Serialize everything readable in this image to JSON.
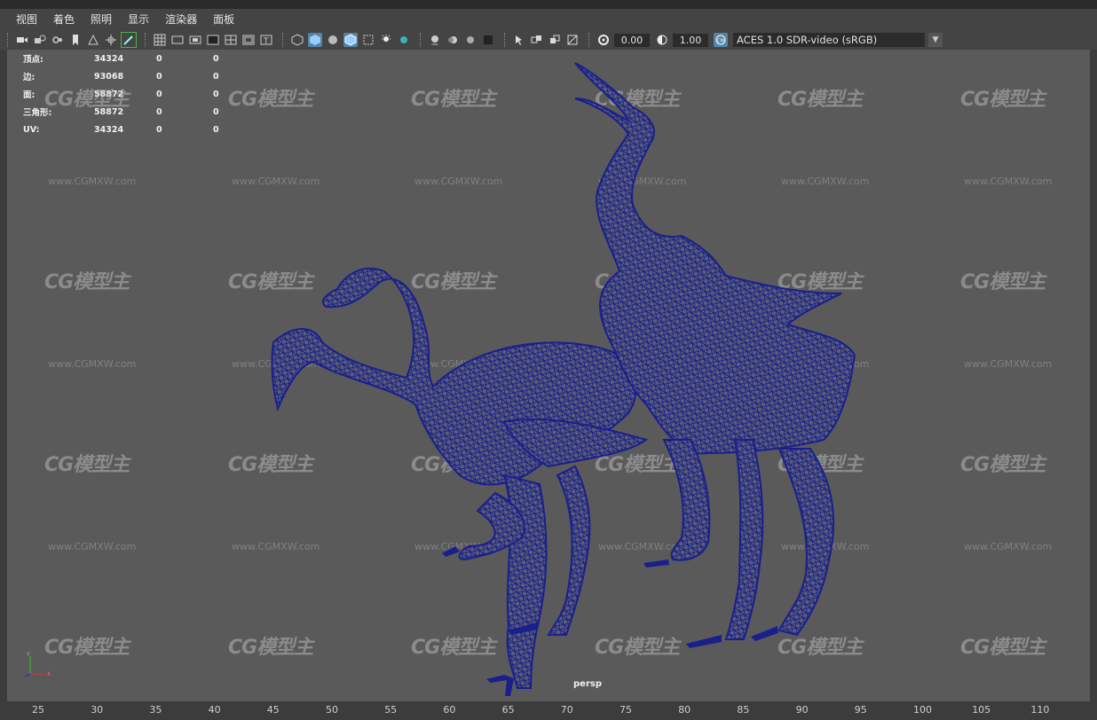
{
  "menu": [
    "视图",
    "着色",
    "照明",
    "显示",
    "渲染器",
    "面板"
  ],
  "toolbar": {
    "exposure_value": "0.00",
    "gamma_value": "1.00",
    "color_space": "ACES 1.0 SDR-video (sRGB)"
  },
  "stats": [
    {
      "label": "顶点:",
      "v1": "34324",
      "v2": "0",
      "v3": "0"
    },
    {
      "label": "边:",
      "v1": "93068",
      "v2": "0",
      "v3": "0"
    },
    {
      "label": "面:",
      "v1": "58872",
      "v2": "0",
      "v3": "0"
    },
    {
      "label": "三角形:",
      "v1": "58872",
      "v2": "0",
      "v3": "0"
    },
    {
      "label": "UV:",
      "v1": "34324",
      "v2": "0",
      "v3": "0"
    }
  ],
  "watermark": {
    "brand": "CG模型主",
    "url": "www.CGMXW.com"
  },
  "camera": "persp",
  "timeline_ticks": [
    "25",
    "30",
    "35",
    "40",
    "45",
    "50",
    "55",
    "60",
    "65",
    "70",
    "75",
    "80",
    "85",
    "90",
    "95",
    "100",
    "105",
    "110"
  ],
  "colors": {
    "wire": "#1a1f8c",
    "viewport_bg": "#5a5a5a",
    "accent": "#5285a6"
  }
}
